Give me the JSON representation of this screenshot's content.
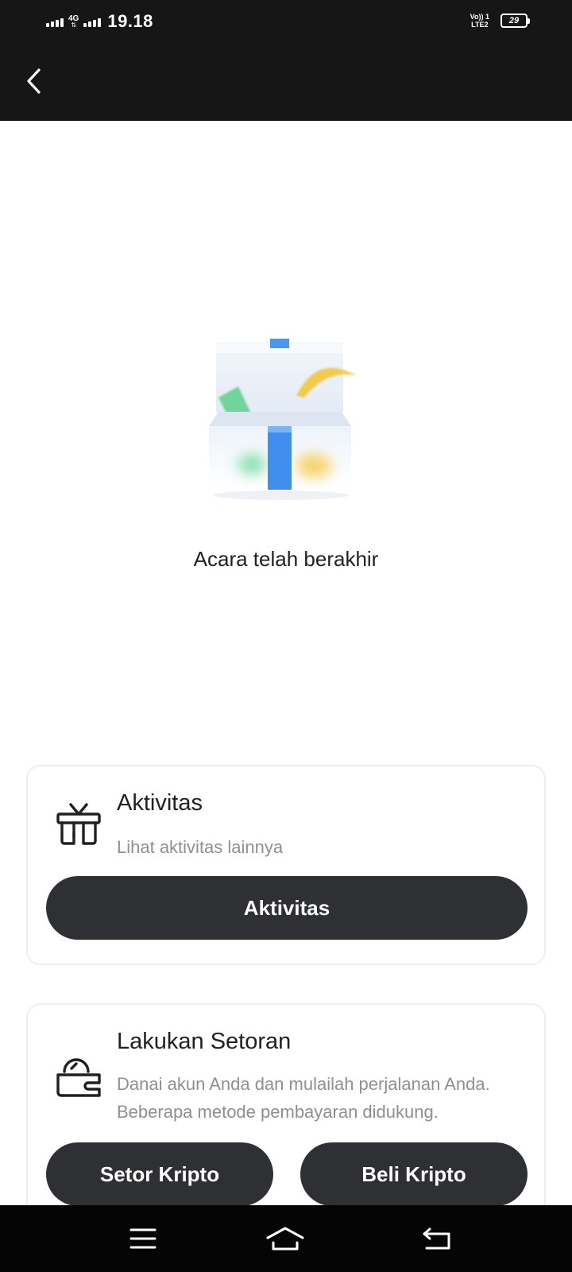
{
  "status_bar": {
    "network_type": "4G",
    "time": "19.18",
    "volte_line1": "Vo)) 1",
    "volte_line2": "LTE2",
    "battery": "29"
  },
  "header": {
    "back_icon": "chevron-left-icon"
  },
  "empty_state": {
    "illustration": "gift-box-illustration",
    "message": "Acara telah berakhir"
  },
  "activity_card": {
    "icon": "gift-icon",
    "title": "Aktivitas",
    "subtitle": "Lihat aktivitas lainnya",
    "button_label": "Aktivitas"
  },
  "deposit_card": {
    "icon": "wallet-clock-icon",
    "title": "Lakukan Setoran",
    "subtitle_line1": "Danai akun Anda dan mulailah perjalanan Anda.",
    "subtitle_line2": "Beberapa metode pembayaran didukung.",
    "button_left_label": "Setor Kripto",
    "button_right_label": "Beli Kripto"
  },
  "nav_bar": {
    "icons": [
      "menu-icon",
      "home-icon",
      "back-icon"
    ]
  },
  "colors": {
    "header_bg": "#161616",
    "button_bg": "#2f3034",
    "subtitle_text": "#8e8f93"
  }
}
